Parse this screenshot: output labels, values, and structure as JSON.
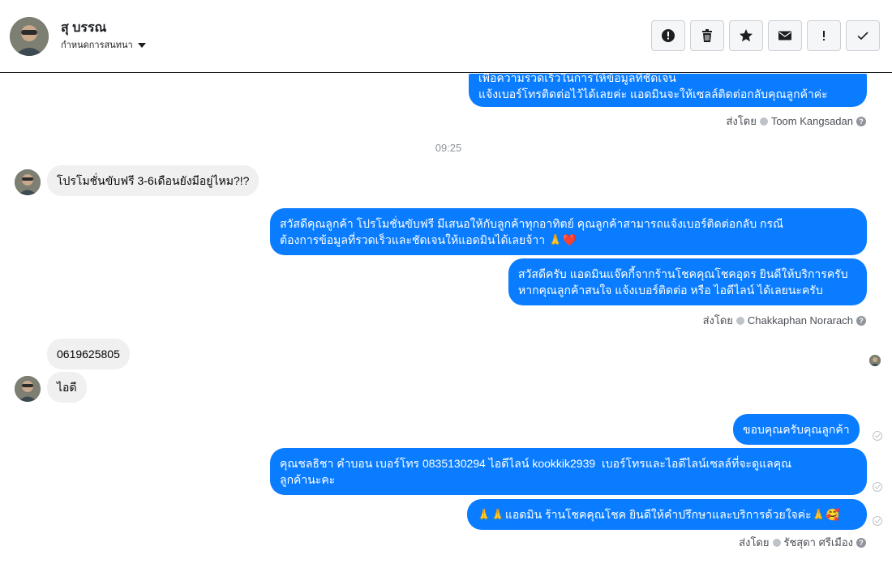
{
  "header": {
    "contact_name": "สุ บรรณ",
    "status_label": "กำหนดการสนทนา"
  },
  "toolbar": {
    "buttons": [
      {
        "name": "report-button",
        "icon": "alert-circle-icon"
      },
      {
        "name": "delete-button",
        "icon": "trash-icon"
      },
      {
        "name": "star-button",
        "icon": "star-icon"
      },
      {
        "name": "mail-button",
        "icon": "envelope-icon"
      },
      {
        "name": "important-button",
        "icon": "exclamation-icon"
      },
      {
        "name": "done-button",
        "icon": "check-icon"
      }
    ]
  },
  "messages": {
    "m0": "เพื่อความรวดเร็วในการให้ข้อมูลที่ชัดเจน\nแจ้งเบอร์โทรติดต่อไว้ได้เลยค่ะ แอดมินจะให้เซลล์ติดต่อกลับคุณลูกค้าค่ะ",
    "sent_by_prefix": "ส่งโดย",
    "sent_by_1": "Toom Kangsadan",
    "time_1": "09:25",
    "m1": "โปรโมชั่นขับฟรี 3-6เดือนยังมีอยู่ไหม?!?",
    "m2": "สวัสดีคุณลูกค้า โปรโมชั่นขับฟรี มีเสนอให้กับลูกค้าทุกอาทิตย์ คุณลูกค้าสามารถแจ้งเบอร์ติดต่อกลับ กรณี\nต้องการข้อมูลที่รวดเร็วและชัดเจนให้แอดมินได้เลยจ้าา 🙏❤️",
    "m3": "สวัสดีครับ แอดมินแจ๊คกี้จากร้านโชคคุณโชคอุดร ยินดีให้บริการครับ\nหากคุณลูกค้าสนใจ แจ้งเบอร์ติดต่อ หรือ ไอดีไลน์ ได้เลยนะครับ",
    "sent_by_2": "Chakkaphan Norarach",
    "m4": "0619625805",
    "m5": "ไอดี",
    "m6": "ขอบคุณครับคุณลูกค้า",
    "m7": "คุณชลธิชา คำบอน เบอร์โทร 0835130294 ไอดีไลน์ kookkik2939  เบอร์โทรและไอดีไลน์เซลล์ที่จะดูแลคุณ\nลูกค้านะคะ",
    "m8": "🙏🙏แอดมิน ร้านโชคคุณโชค ยินดีให้คำปรึกษาและบริการด้วยใจค่ะ🙏🥰",
    "sent_by_3": "รัชสุดา ศรีเมือง"
  },
  "colors": {
    "outgoing_bubble": "#0a7cff",
    "incoming_bubble": "#f0f0f0"
  }
}
